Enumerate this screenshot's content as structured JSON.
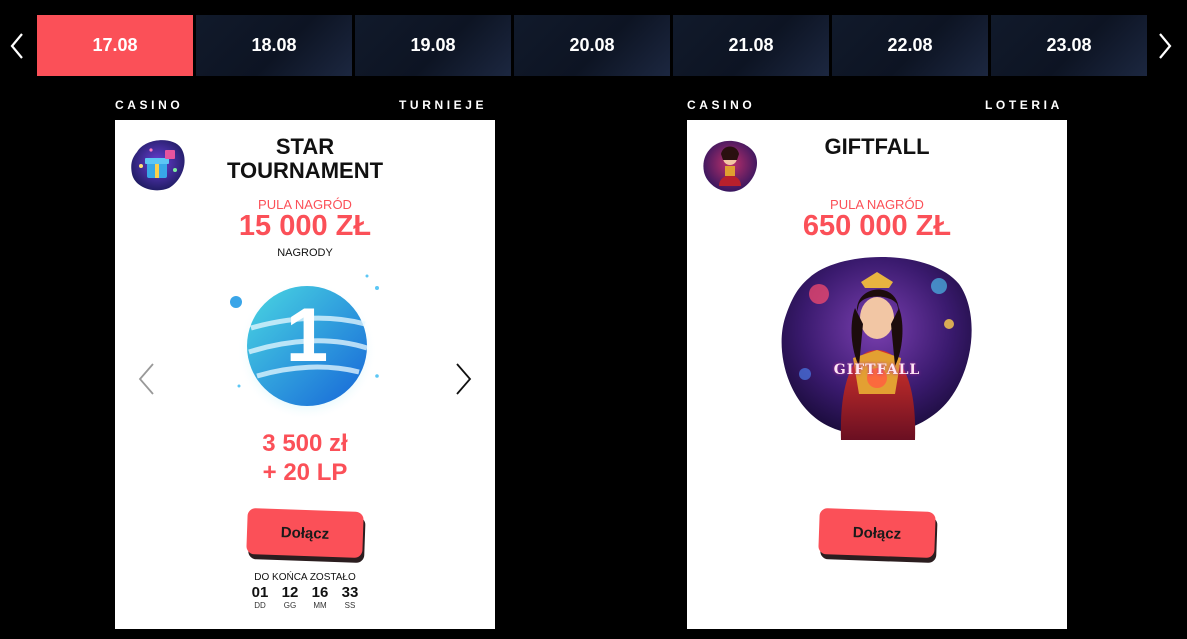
{
  "colors": {
    "accent": "#fb5058",
    "tab_bg": "#111a2b",
    "card_bg": "#ffffff",
    "page_bg": "#000000"
  },
  "date_tabs": [
    {
      "label": "17.08",
      "active": true
    },
    {
      "label": "18.08",
      "active": false
    },
    {
      "label": "19.08",
      "active": false
    },
    {
      "label": "20.08",
      "active": false
    },
    {
      "label": "21.08",
      "active": false
    },
    {
      "label": "22.08",
      "active": false
    },
    {
      "label": "23.08",
      "active": false
    }
  ],
  "nav": {
    "prev_icon": "chevron-left-icon",
    "next_icon": "chevron-right-icon"
  },
  "cards": [
    {
      "category": "CASINO",
      "type": "TURNIEJE",
      "icon": "gift-game-thumbnail",
      "title_line1": "STAR",
      "title_line2": "TOURNAMENT",
      "prize_label": "PULA NAGRÓD",
      "prize_amount": "15 000 ZŁ",
      "prizes_label": "NAGRODY",
      "place": "1",
      "reward_line1": "3 500 zł",
      "reward_line2": "+ 20 LP",
      "join_label": "Dołącz",
      "countdown": {
        "label": "DO KOŃCA ZOSTAŁO",
        "units": [
          {
            "value": "01",
            "label": "DD"
          },
          {
            "value": "12",
            "label": "GG"
          },
          {
            "value": "16",
            "label": "MM"
          },
          {
            "value": "33",
            "label": "SS"
          }
        ]
      }
    },
    {
      "category": "CASINO",
      "type": "LOTERIA",
      "icon": "giftfall-game-thumbnail",
      "title_line1": "GIFTFALL",
      "prize_label": "PULA NAGRÓD",
      "prize_amount": "650 000 ZŁ",
      "artwork_text": "GIFTFALL",
      "join_label": "Dołącz"
    }
  ]
}
